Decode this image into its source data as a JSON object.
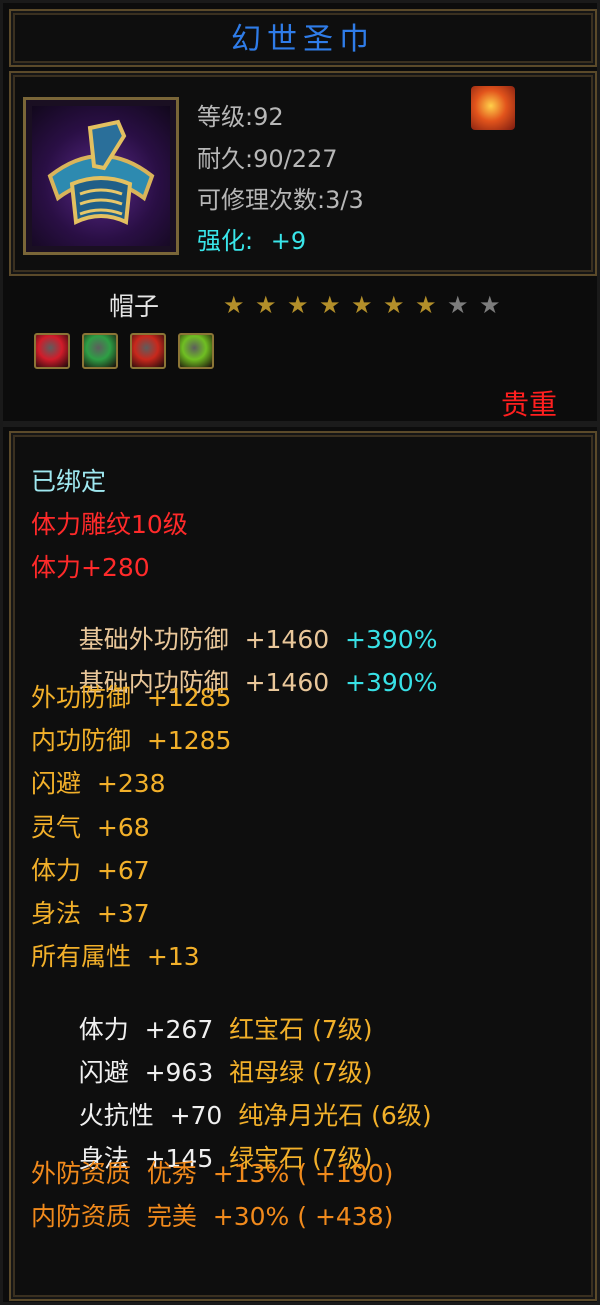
{
  "item": {
    "name": "幻世圣巾",
    "level_text": "等级:92",
    "durability_text": "耐久:90/227",
    "repair_text": "可修理次数:3/3",
    "enhance_label": "强化:",
    "enhance_value": "+9",
    "type": "帽子",
    "rarity": "贵重",
    "stars_total": 9,
    "stars_filled": 7,
    "star_colors": {
      "filled": "#b38f2a",
      "empty": "#7d7d7d"
    },
    "item_icon": "headband-icon",
    "corner_icon": "fire-swirl-icon",
    "gems": [
      {
        "name": "red-gem-icon",
        "color": "#d11c2a"
      },
      {
        "name": "green-gem-icon",
        "color": "#2e9f45"
      },
      {
        "name": "red-feather-gem-icon",
        "color": "#c8281c"
      },
      {
        "name": "lime-gem-icon",
        "color": "#6fbf22"
      }
    ]
  },
  "attributes": [
    {
      "parts": [
        "已绑定"
      ]
    },
    {
      "parts": [
        "体力雕纹10级"
      ]
    },
    {
      "parts": [
        "体力+280"
      ]
    },
    {
      "parts": [
        "基础外功防御  +1460  ",
        "+390%"
      ]
    },
    {
      "parts": [
        "基础内功防御  +1460  ",
        "+390%"
      ]
    },
    {
      "parts": [
        "外功防御  +1285"
      ]
    },
    {
      "parts": [
        "内功防御  +1285"
      ]
    },
    {
      "parts": [
        "闪避  +238"
      ]
    },
    {
      "parts": [
        "灵气  +68"
      ]
    },
    {
      "parts": [
        "体力  +67"
      ]
    },
    {
      "parts": [
        "身法  +37"
      ]
    },
    {
      "parts": [
        "所有属性  +13"
      ]
    },
    {
      "parts": [
        "体力  +267  ",
        "红宝石 (7级)"
      ]
    },
    {
      "parts": [
        "闪避  +963  ",
        "祖母绿 (7级)"
      ]
    },
    {
      "parts": [
        "火抗性  +70  ",
        "纯净月光石 (6级)"
      ]
    },
    {
      "parts": [
        "身法  +145  ",
        "绿宝石 (7级)"
      ]
    },
    {
      "parts": [
        "外防资质  优秀  +13% ( +190)"
      ]
    },
    {
      "parts": [
        "内防资质  完美  +30% ( +438)"
      ]
    }
  ]
}
